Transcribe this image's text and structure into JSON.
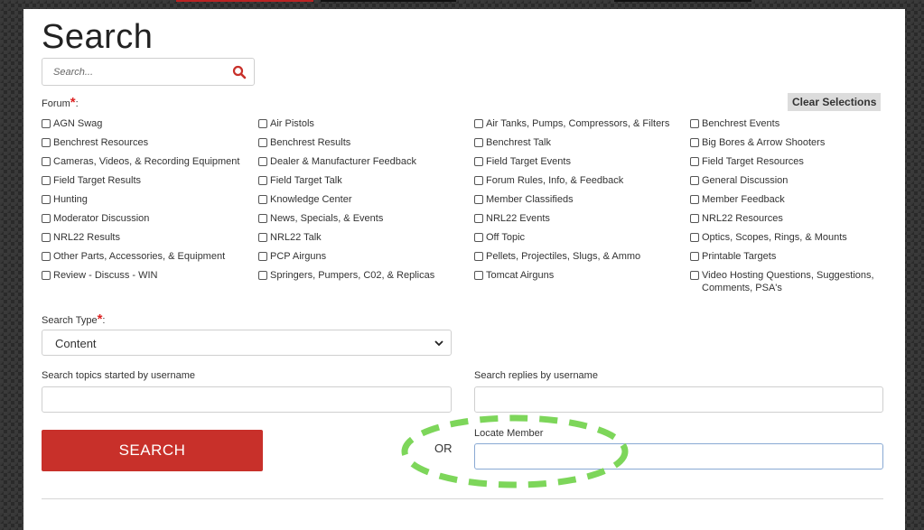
{
  "page_title": "Search",
  "search": {
    "placeholder": "Search...",
    "icon": "search-icon",
    "icon_color": "#c8302a"
  },
  "forum": {
    "label": "Forum",
    "required_mark": "*",
    "clear_label": "Clear Selections",
    "options": [
      "AGN Swag",
      "Air Pistols",
      "Air Tanks, Pumps, Compressors, & Filters",
      "Benchrest Events",
      "Benchrest Resources",
      "Benchrest Results",
      "Benchrest Talk",
      "Big Bores & Arrow Shooters",
      "Cameras, Videos, & Recording Equipment",
      "Dealer & Manufacturer Feedback",
      "Field Target Events",
      "Field Target Resources",
      "Field Target Results",
      "Field Target Talk",
      "Forum Rules, Info, & Feedback",
      "General Discussion",
      "Hunting",
      "Knowledge Center",
      "Member Classifieds",
      "Member Feedback",
      "Moderator Discussion",
      "News, Specials, & Events",
      "NRL22 Events",
      "NRL22 Resources",
      "NRL22 Results",
      "NRL22 Talk",
      "Off Topic",
      "Optics, Scopes, Rings, & Mounts",
      "Other Parts, Accessories, & Equipment",
      "PCP Airguns",
      "Pellets, Projectiles, Slugs, & Ammo",
      "Printable Targets",
      "Review - Discuss - WIN",
      "Springers, Pumpers, C02, & Replicas",
      "Tomcat Airguns",
      "Video Hosting Questions, Suggestions, Comments, PSA's"
    ]
  },
  "search_type": {
    "label": "Search Type",
    "required_mark": "*",
    "selected": "Content"
  },
  "topics_by_username": {
    "label": "Search topics started by username"
  },
  "replies_by_username": {
    "label": "Search replies by username"
  },
  "search_button": {
    "label": "SEARCH",
    "color": "#c8302a"
  },
  "or_text": "OR",
  "locate_member": {
    "label": "Locate Member"
  },
  "highlight": {
    "color": "#7dd65a"
  }
}
